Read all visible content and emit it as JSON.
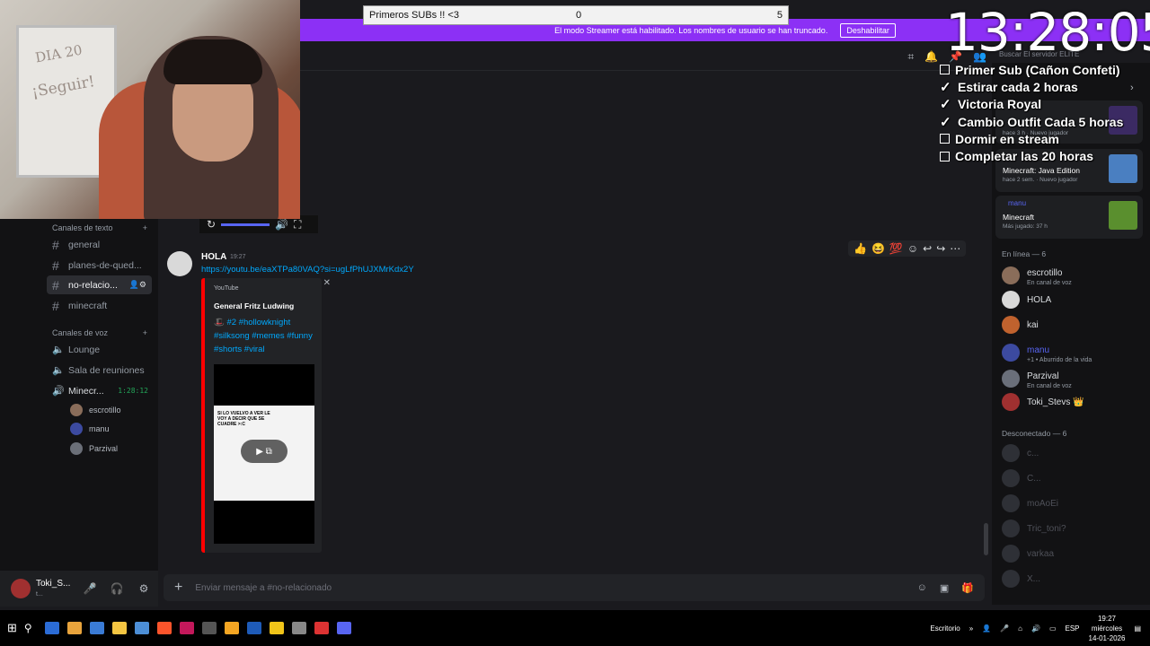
{
  "overlay": {
    "subs_label": "Primeros SUBs !! <3",
    "subs_current": "0",
    "subs_goal": "5",
    "clock": "13:28:05",
    "checklist": [
      {
        "label": "Primer Sub (Cañon Confeti)",
        "done": false
      },
      {
        "label": "Estirar cada 2 horas",
        "done": true
      },
      {
        "label": "Victoria Royal",
        "done": true
      },
      {
        "label": "Cambio Outfit Cada 5 horas",
        "done": true
      },
      {
        "label": "Dormir en stream",
        "done": false
      },
      {
        "label": "Completar las 20 horas",
        "done": false
      }
    ]
  },
  "banner": {
    "text": "El modo Streamer está habilitado. Los nombres de usuario se han truncado.",
    "button": "Deshabilitar"
  },
  "search_placeholder": "Buscar El servidor ELITE",
  "sidebar": {
    "text_section": "Canales de texto",
    "text_channels": [
      {
        "name": "general"
      },
      {
        "name": "planes-de-qued..."
      },
      {
        "name": "no-relacio...",
        "active": true
      },
      {
        "name": "minecraft"
      }
    ],
    "voice_section": "Canales de voz",
    "voice_channels": [
      {
        "name": "Lounge"
      },
      {
        "name": "Sala de reuniones"
      },
      {
        "name": "Minecr...",
        "timer": "1:28:12"
      }
    ],
    "voice_users": [
      "escrotillo",
      "manu",
      "Parzival"
    ]
  },
  "user_panel": {
    "name": "Toki_S...",
    "status": "t..."
  },
  "message": {
    "author": "HOLA",
    "time": "19:27",
    "link": "https://youtu.be/eaXTPa80VAQ?si=ugLfPhUJXMrKdx2Y",
    "embed": {
      "provider": "YouTube",
      "title": "General Fritz Ludwing",
      "description": "🎩 #2 #hollowknight #silksong #memes #funny #shorts #viral",
      "frame_text": "SI LO VUELVO A VER LE VOY A DECIR QUE SE CUADRE >:C"
    }
  },
  "composer_placeholder": "Enviar mensaje a #no-relacionado",
  "members": {
    "activity_cards": [
      {
        "user": "",
        "game": "",
        "meta": "hace 3 h · Nuevo jugador",
        "img_color": "#3b2a63"
      },
      {
        "user": "",
        "game": "Minecraft: Java Edition",
        "meta": "hace 2 sem. · Nuevo jugador",
        "img_color": "#4a7fc1"
      },
      {
        "user": "manu",
        "game": "Minecraft",
        "meta": "Más jugado: 37 h",
        "img_color": "#5a8f2e"
      }
    ],
    "online_label": "En línea — 6",
    "online": [
      {
        "name": "escrotillo",
        "status": "En canal de voz",
        "color": "#8a6d5a"
      },
      {
        "name": "HOLA",
        "status": "",
        "color": "#d9d9d9"
      },
      {
        "name": "kai",
        "status": "",
        "color": "#c0622e"
      },
      {
        "name": "manu",
        "status": "+1 • Aburrido de la vida",
        "color": "#3c4aa0",
        "blue": true
      },
      {
        "name": "Parzival",
        "status": "En canal de voz",
        "color": "#6a6f7a"
      },
      {
        "name": "Toki_Stevs 👑",
        "status": "",
        "color": "#a03030"
      }
    ],
    "offline_label": "Desconectado — 6",
    "offline": [
      "c...",
      "C...",
      "moAoEi",
      "Tric_toni?",
      "varkaa",
      "X..."
    ]
  },
  "taskbar": {
    "desktop": "Escritorio",
    "lang": "ESP",
    "time": "19:27",
    "day": "miércoles",
    "date": "14-01-2026",
    "icon_colors": [
      "#2b6cd6",
      "#e8a33c",
      "#3a7bd5",
      "#f4c542",
      "#4c8ed6",
      "#fb542b",
      "#c2185b",
      "#555",
      "#f5a623",
      "#1e5bb8",
      "#f0c419",
      "#888",
      "#d33",
      "#5865f2"
    ]
  }
}
